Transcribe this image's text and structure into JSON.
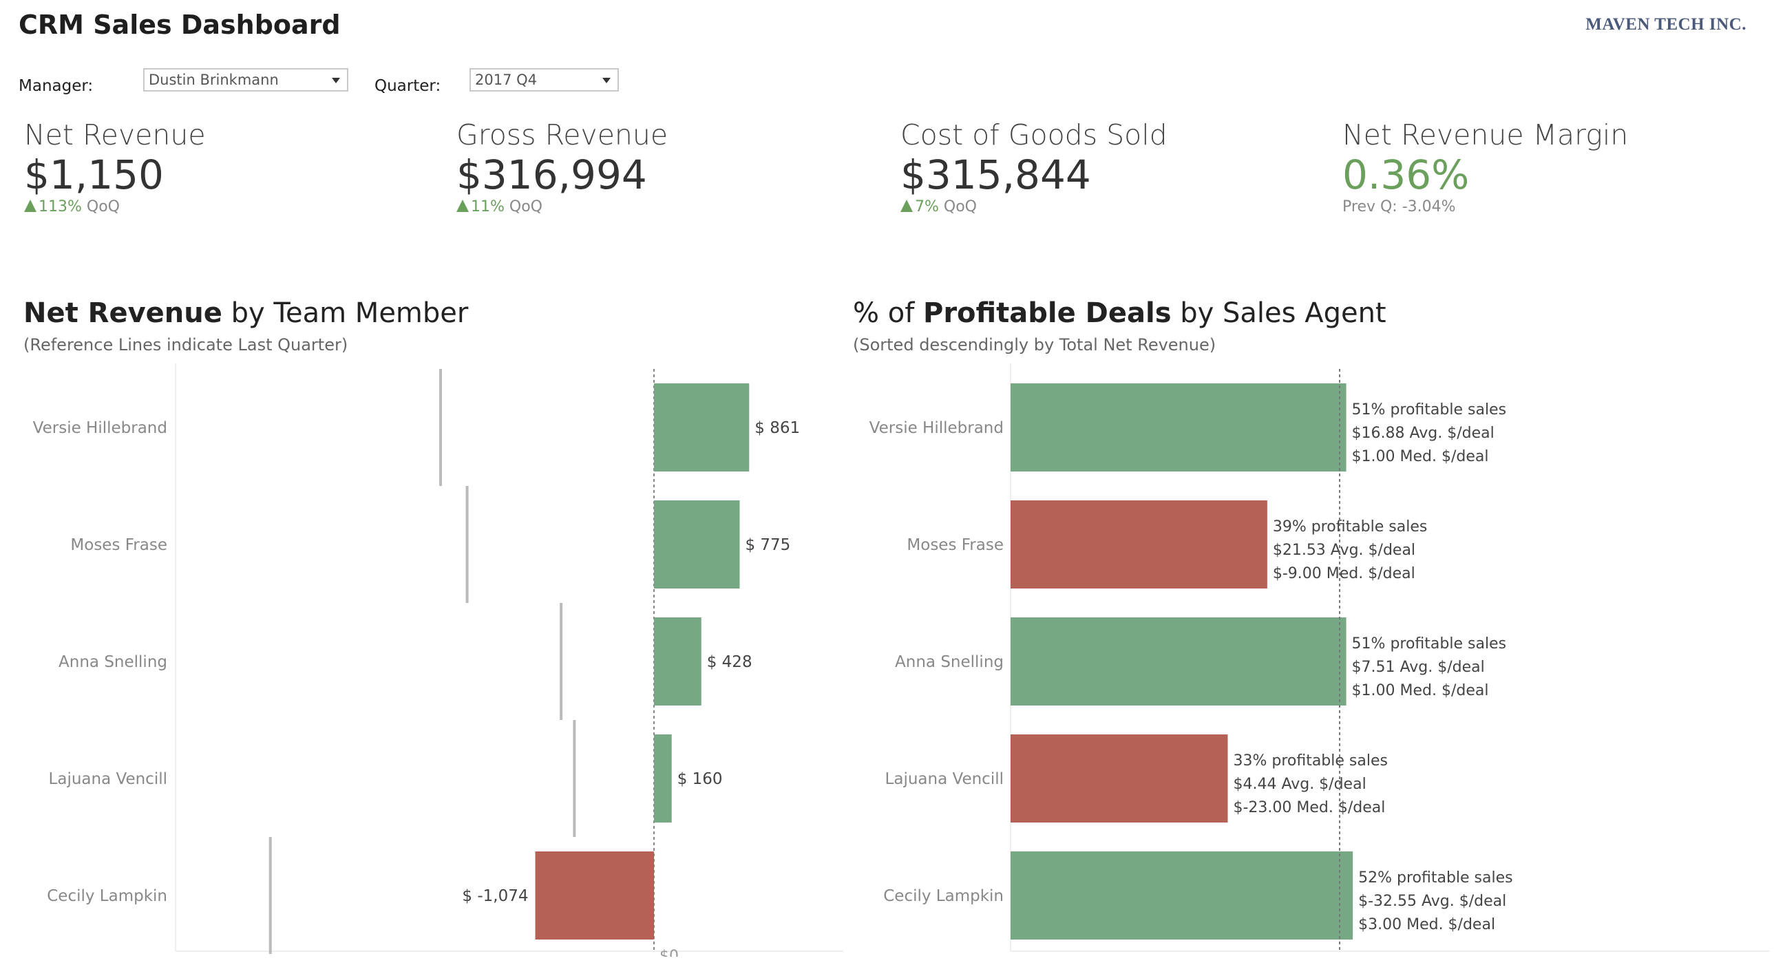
{
  "header": {
    "title": "CRM Sales Dashboard",
    "logo_text": "MAVEN TECH INC."
  },
  "filters": {
    "manager_label": "Manager:",
    "manager_value": "Dustin Brinkmann",
    "quarter_label": "Quarter:",
    "quarter_value": "2017 Q4"
  },
  "kpis": [
    {
      "label": "Net Revenue",
      "value": "$1,150",
      "change": "113%",
      "change_suffix": " QoQ"
    },
    {
      "label": "Gross Revenue",
      "value": "$316,994",
      "change": "11%",
      "change_suffix": " QoQ"
    },
    {
      "label": "Cost of Goods Sold",
      "value": "$315,844",
      "change": "7%",
      "change_suffix": " QoQ"
    },
    {
      "label": "Net Revenue Margin",
      "value": "0.36%",
      "prev": "Prev Q: -3.04%"
    }
  ],
  "colors": {
    "positive": "#76a883",
    "negative": "#b66156",
    "kpi_green": "#6aa05c",
    "ref_line": "#bbbbbb"
  },
  "left_chart": {
    "title_bold": "Net Revenue",
    "title_rest": " by Team Member",
    "subtitle": "(Reference Lines indicate Last Quarter)"
  },
  "right_chart": {
    "title_pre": "% of ",
    "title_bold": "Profitable Deals",
    "title_rest": " by Sales Agent",
    "subtitle": "(Sorted descendingly by Total Net Revenue)"
  },
  "chart_data": [
    {
      "type": "bar",
      "orientation": "horizontal",
      "categories": [
        "Versie Hillebrand",
        "Moses Frase",
        "Anna Snelling",
        "Lajuana Vencill",
        "Cecily Lampkin"
      ],
      "values": [
        861,
        775,
        428,
        160,
        -1074
      ],
      "value_labels": [
        "$ 861",
        "$ 775",
        "$ 428",
        "$ 160",
        "$ -1,074"
      ],
      "reference_values_last_quarter": [
        -1930,
        -1690,
        -840,
        -720,
        -3470
      ],
      "zero_label": "$0"
    },
    {
      "type": "bar",
      "orientation": "horizontal",
      "categories": [
        "Versie Hillebrand",
        "Moses Frase",
        "Anna Snelling",
        "Lajuana Vencill",
        "Cecily Lampkin"
      ],
      "values": [
        0.51,
        0.39,
        0.51,
        0.33,
        0.52
      ],
      "reference_value": 0.5,
      "labels": [
        [
          "51% profitable sales",
          "$16.88 Avg. $/deal",
          "$1.00 Med. $/deal"
        ],
        [
          "39% profitable sales",
          "$21.53 Avg. $/deal",
          "$-9.00 Med. $/deal"
        ],
        [
          "51% profitable sales",
          "$7.51 Avg. $/deal",
          "$1.00 Med. $/deal"
        ],
        [
          "33% profitable sales",
          "$4.44 Avg. $/deal",
          "$-23.00 Med. $/deal"
        ],
        [
          "52% profitable sales",
          "$-32.55 Avg. $/deal",
          "$3.00 Med. $/deal"
        ]
      ]
    }
  ]
}
